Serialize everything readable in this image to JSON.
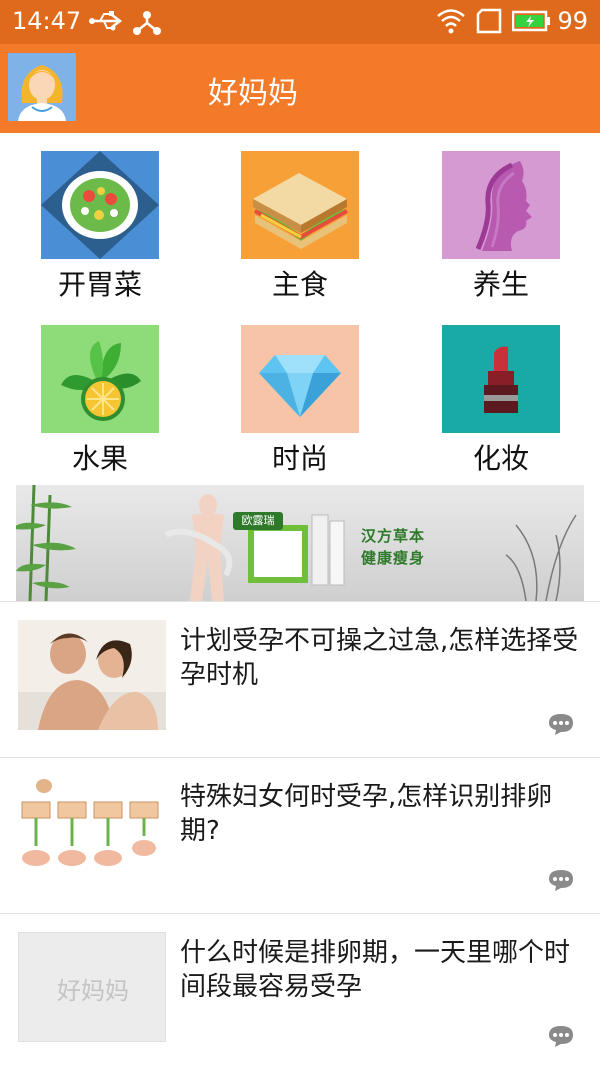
{
  "status_bar": {
    "time": "14:47",
    "battery": "99",
    "icons": [
      "usb-icon",
      "share-icon",
      "wifi-icon",
      "sim-icon",
      "battery-icon"
    ]
  },
  "app_bar": {
    "title": "好妈妈",
    "avatar": "avatar-girl-icon"
  },
  "grid": {
    "items": [
      {
        "label": "开胃菜",
        "icon": "salad-icon",
        "color": "#4a8fd6"
      },
      {
        "label": "主食",
        "icon": "sandwich-icon",
        "color": "#f7a037"
      },
      {
        "label": "养生",
        "icon": "face-profile-icon",
        "color": "#d59ad2"
      },
      {
        "label": "水果",
        "icon": "lime-icon",
        "color": "#8edb7a"
      },
      {
        "label": "时尚",
        "icon": "diamond-icon",
        "color": "#f7c4a8"
      },
      {
        "label": "化妆",
        "icon": "lipstick-icon",
        "color": "#1aaaa5"
      }
    ]
  },
  "banner": {
    "brand": "欧露瑞",
    "line1": "汉方草本",
    "line2": "健康瘦身"
  },
  "articles": [
    {
      "title": "计划受孕不可操之过急,怎样选择受孕时机",
      "thumb": "couple-photo"
    },
    {
      "title": "特殊妇女何时受孕,怎样识别排卵期?",
      "thumb": "ovulation-diagram"
    },
    {
      "title": "什么时候是排卵期，一天里哪个时间段最容易受孕",
      "thumb": "placeholder",
      "placeholder_text": "好妈妈"
    }
  ]
}
